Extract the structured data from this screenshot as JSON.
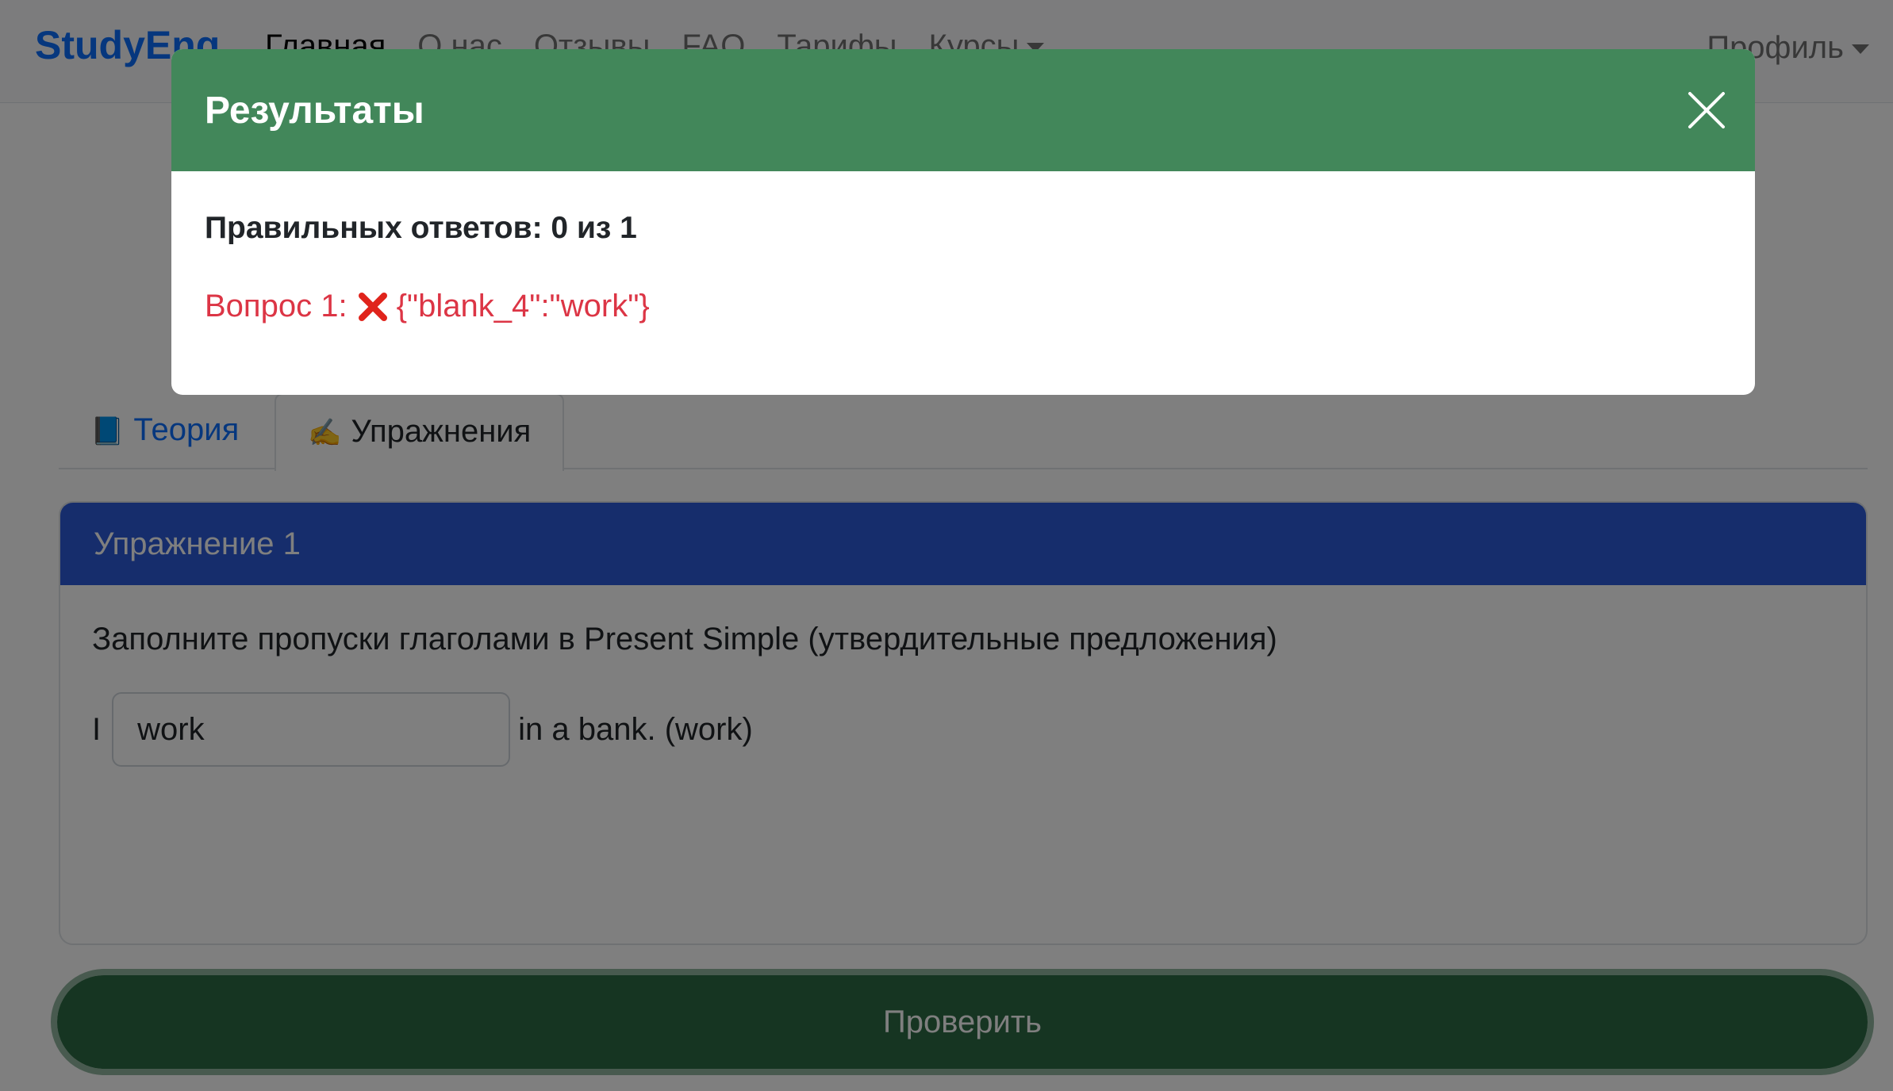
{
  "navbar": {
    "brand": "StudyEng",
    "links": [
      "Главная",
      "О нас",
      "Отзывы",
      "FAQ",
      "Тарифы",
      "Курсы"
    ],
    "profile": "Профиль"
  },
  "tabs": [
    {
      "emoji": "📘",
      "label": "Теория"
    },
    {
      "emoji": "✍️",
      "label": "Упражнения"
    }
  ],
  "exercise": {
    "title": "Упражнение 1",
    "instruction": "Заполните пропуски глаголами в Present Simple (утвердительные предложения)",
    "sentence_before": "I",
    "input_value": "work",
    "sentence_after": "in a bank. (work)"
  },
  "check_button": "Проверить",
  "modal": {
    "title": "Результаты",
    "score": "Правильных ответов: 0 из 1",
    "answer_label": "Вопрос 1:",
    "answer_value": "{\"blank_4\":\"work\"}",
    "accent_color": "#42875a",
    "error_color": "#dc3545"
  }
}
